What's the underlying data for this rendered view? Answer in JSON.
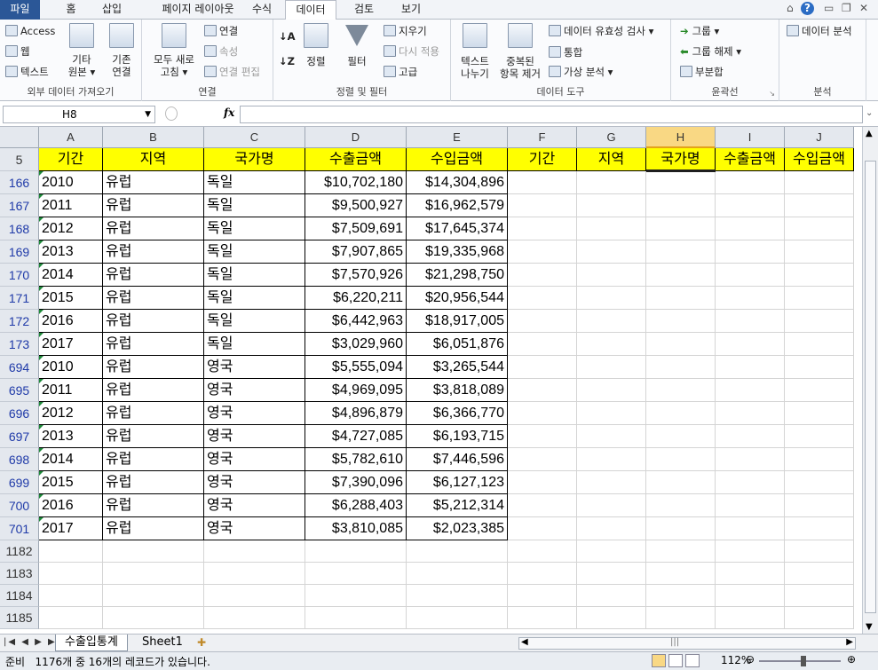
{
  "tabs": [
    "파일",
    "홈",
    "삽입",
    "페이지 레이아웃",
    "수식",
    "데이터",
    "검토",
    "보기"
  ],
  "ribbon": {
    "ext": {
      "access": "Access",
      "web": "웹",
      "text": "텍스트",
      "other": "기타\n원본 ▾",
      "existing": "기존\n연결",
      "label": "외부 데이터 가져오기"
    },
    "conn": {
      "refresh": "모두 새로\n고침 ▾",
      "connections": "연결",
      "properties": "속성",
      "edit_links": "연결 편집",
      "label": "연결"
    },
    "sort": {
      "sort": "정렬",
      "filter": "필터",
      "clear": "지우기",
      "reapply": "다시 적용",
      "advanced": "고급",
      "label": "정렬 및 필터"
    },
    "tools": {
      "text_to_columns": "텍스트\n나누기",
      "remove_dup": "중복된\n항목 제거",
      "validation": "데이터 유효성 검사 ▾",
      "consolidate": "통합",
      "whatif": "가상 분석 ▾",
      "label": "데이터 도구"
    },
    "outline": {
      "group": "그룹 ▾",
      "ungroup": "그룹 해제 ▾",
      "subtotal": "부분합",
      "label": "윤곽선"
    },
    "analysis": {
      "data_analysis": "데이터 분석",
      "label": "분석"
    }
  },
  "namebox": "H8",
  "columns": [
    "A",
    "B",
    "C",
    "D",
    "E",
    "F",
    "G",
    "H",
    "I",
    "J"
  ],
  "header_row": {
    "num": "5",
    "cells": [
      "기간",
      "지역",
      "국가명",
      "수출금액",
      "수입금액",
      "기간",
      "지역",
      "국가명",
      "수출금액",
      "수입금액"
    ]
  },
  "rows": [
    {
      "num": "166",
      "year": "2010",
      "region": "유럽",
      "country": "독일",
      "export": "$10,702,180",
      "import": "$14,304,896"
    },
    {
      "num": "167",
      "year": "2011",
      "region": "유럽",
      "country": "독일",
      "export": "$9,500,927",
      "import": "$16,962,579"
    },
    {
      "num": "168",
      "year": "2012",
      "region": "유럽",
      "country": "독일",
      "export": "$7,509,691",
      "import": "$17,645,374"
    },
    {
      "num": "169",
      "year": "2013",
      "region": "유럽",
      "country": "독일",
      "export": "$7,907,865",
      "import": "$19,335,968"
    },
    {
      "num": "170",
      "year": "2014",
      "region": "유럽",
      "country": "독일",
      "export": "$7,570,926",
      "import": "$21,298,750"
    },
    {
      "num": "171",
      "year": "2015",
      "region": "유럽",
      "country": "독일",
      "export": "$6,220,211",
      "import": "$20,956,544"
    },
    {
      "num": "172",
      "year": "2016",
      "region": "유럽",
      "country": "독일",
      "export": "$6,442,963",
      "import": "$18,917,005"
    },
    {
      "num": "173",
      "year": "2017",
      "region": "유럽",
      "country": "독일",
      "export": "$3,029,960",
      "import": "$6,051,876"
    },
    {
      "num": "694",
      "year": "2010",
      "region": "유럽",
      "country": "영국",
      "export": "$5,555,094",
      "import": "$3,265,544"
    },
    {
      "num": "695",
      "year": "2011",
      "region": "유럽",
      "country": "영국",
      "export": "$4,969,095",
      "import": "$3,818,089"
    },
    {
      "num": "696",
      "year": "2012",
      "region": "유럽",
      "country": "영국",
      "export": "$4,896,879",
      "import": "$6,366,770"
    },
    {
      "num": "697",
      "year": "2013",
      "region": "유럽",
      "country": "영국",
      "export": "$4,727,085",
      "import": "$6,193,715"
    },
    {
      "num": "698",
      "year": "2014",
      "region": "유럽",
      "country": "영국",
      "export": "$5,782,610",
      "import": "$7,446,596"
    },
    {
      "num": "699",
      "year": "2015",
      "region": "유럽",
      "country": "영국",
      "export": "$7,390,096",
      "import": "$6,127,123"
    },
    {
      "num": "700",
      "year": "2016",
      "region": "유럽",
      "country": "영국",
      "export": "$6,288,403",
      "import": "$5,212,314"
    },
    {
      "num": "701",
      "year": "2017",
      "region": "유럽",
      "country": "영국",
      "export": "$3,810,085",
      "import": "$2,023,385"
    }
  ],
  "empty_rows": [
    "1182",
    "1183",
    "1184",
    "1185"
  ],
  "sheets": [
    "수출입통계",
    "Sheet1"
  ],
  "status": {
    "ready": "준비",
    "message": "1176개 중 16개의 레코드가 있습니다.",
    "zoom": "112%"
  }
}
